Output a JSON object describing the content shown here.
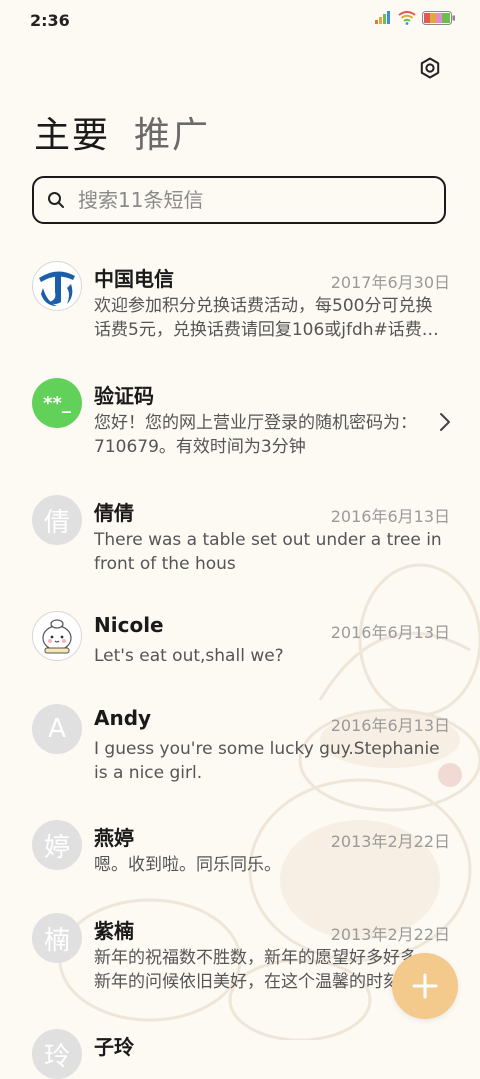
{
  "status_bar": {
    "time": "2:36",
    "icons": [
      "signal-icon",
      "wifi-icon",
      "battery-icon"
    ]
  },
  "header": {
    "settings_icon": "gear-icon"
  },
  "tabs": [
    {
      "label": "主要",
      "active": true
    },
    {
      "label": "推广",
      "active": false
    }
  ],
  "search": {
    "placeholder": "搜索11条短信",
    "value": ""
  },
  "conversations": [
    {
      "name": "中国电信",
      "date": "2017年6月30日",
      "preview": "欢迎参加积分兑换话费活动，每500分可兑换话费5元，兑换话费请回复106或jfdh#话费…",
      "avatar": "china-telecom-logo"
    },
    {
      "name": "验证码",
      "date": "",
      "preview": "您好！您的网上营业厅登录的随机密码为：710679。有效时间为3分钟",
      "avatar_text": "**_"
    },
    {
      "name": "倩倩",
      "date": "2016年6月13日",
      "preview": "There was a table set out under a tree in front of the hous",
      "avatar_text": "倩"
    },
    {
      "name": "Nicole",
      "date": "2016年6月13日",
      "preview": "Let's eat out,shall we?",
      "avatar": "cartoon-avatar"
    },
    {
      "name": "Andy",
      "date": "2016年6月13日",
      "preview": "I guess you're some lucky guy.Stephanie is a nice girl.",
      "avatar_text": "A"
    },
    {
      "name": "燕婷",
      "date": "2013年2月22日",
      "preview": "嗯。收到啦。同乐同乐。",
      "avatar_text": "婷"
    },
    {
      "name": "紫楠",
      "date": "2013年2月22日",
      "preview": "新年的祝福数不胜数，新年的愿望好多好多，新年的问候依旧美好，在这个温馨的时刻",
      "avatar_text": "楠"
    },
    {
      "name": "子玲",
      "date": "",
      "preview": "",
      "avatar_text": "玲"
    }
  ],
  "fab": {
    "icon": "plus-icon"
  },
  "colors": {
    "background": "#fdf9f3",
    "fab": "#f3c98c",
    "verification_avatar": "#62d15a",
    "telecom_blue": "#1b5fab"
  }
}
